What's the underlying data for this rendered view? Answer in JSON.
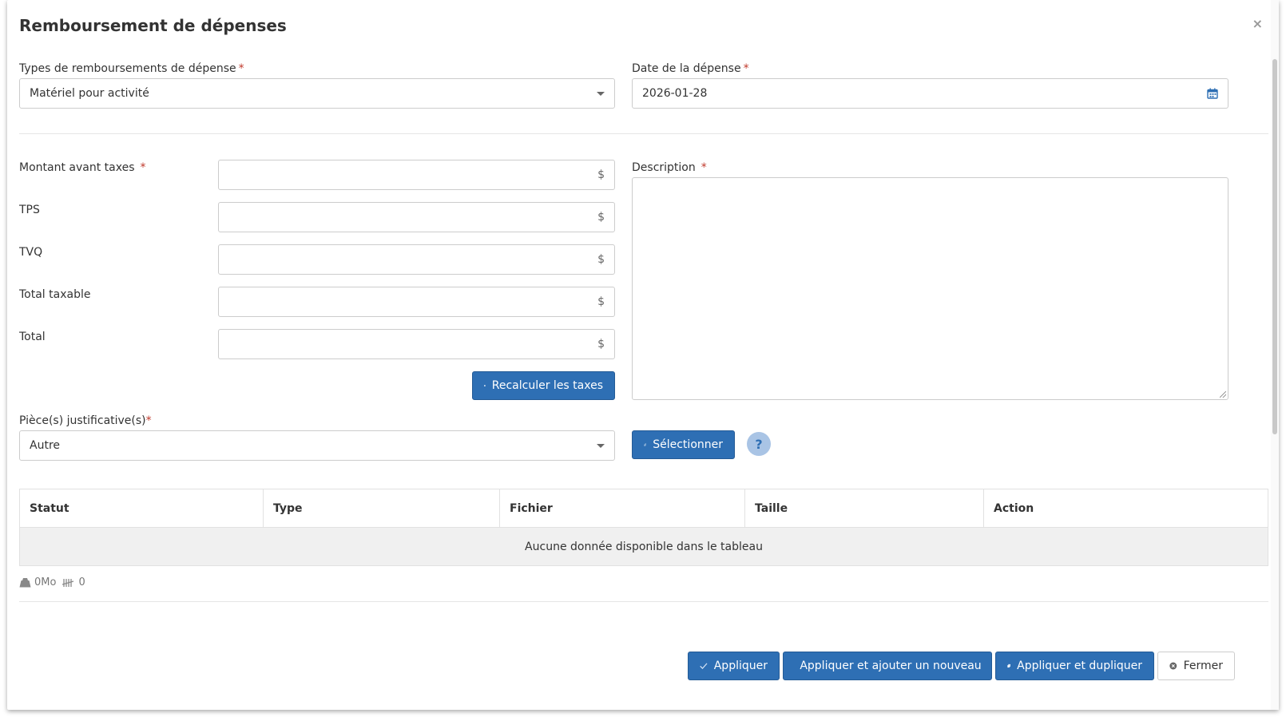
{
  "dialog": {
    "title": "Remboursement de dépenses",
    "close_symbol": "×"
  },
  "fields": {
    "expense_type": {
      "label": "Types de remboursements de dépense",
      "required": "*",
      "value": "Matériel pour activité"
    },
    "expense_date": {
      "label": "Date de la dépense",
      "required": "*",
      "value": "2026-01-28",
      "icon": "calendar-icon"
    },
    "amount_before_tax": {
      "label": "Montant avant taxes",
      "required": "*",
      "suffix": "$",
      "value": ""
    },
    "tps": {
      "label": "TPS",
      "suffix": "$",
      "value": ""
    },
    "tvq": {
      "label": "TVQ",
      "suffix": "$",
      "value": ""
    },
    "total_taxable": {
      "label": "Total taxable",
      "suffix": "$",
      "value": ""
    },
    "total": {
      "label": "Total",
      "suffix": "$",
      "value": ""
    },
    "description": {
      "label": "Description",
      "required": "*",
      "value": ""
    },
    "supporting_docs": {
      "label": "Pièce(s) justificative(s)",
      "required": "*",
      "value": "Autre"
    }
  },
  "buttons": {
    "recalculate": {
      "label": "Recalculer les taxes",
      "icon": "calculator-icon"
    },
    "select_file": {
      "label": "Sélectionner",
      "icon": "paperclip-icon"
    },
    "help": {
      "label": "?"
    },
    "apply": {
      "label": "Appliquer",
      "icon": "check-icon"
    },
    "apply_add_new": {
      "label": "Appliquer et ajouter un nouveau",
      "icon": "plus-icon"
    },
    "apply_duplicate": {
      "label": "Appliquer et dupliquer",
      "icon": "copy-icon"
    },
    "close": {
      "label": "Fermer",
      "icon": "close-circle-icon"
    }
  },
  "files_table": {
    "columns": [
      "Statut",
      "Type",
      "Fichier",
      "Taille",
      "Action"
    ],
    "empty_message": "Aucune donnée disponible dans le tableau"
  },
  "stats": {
    "size": "0Mo",
    "count": "0"
  },
  "colors": {
    "primary": "#2e6fb4",
    "required": "#c0392b"
  }
}
